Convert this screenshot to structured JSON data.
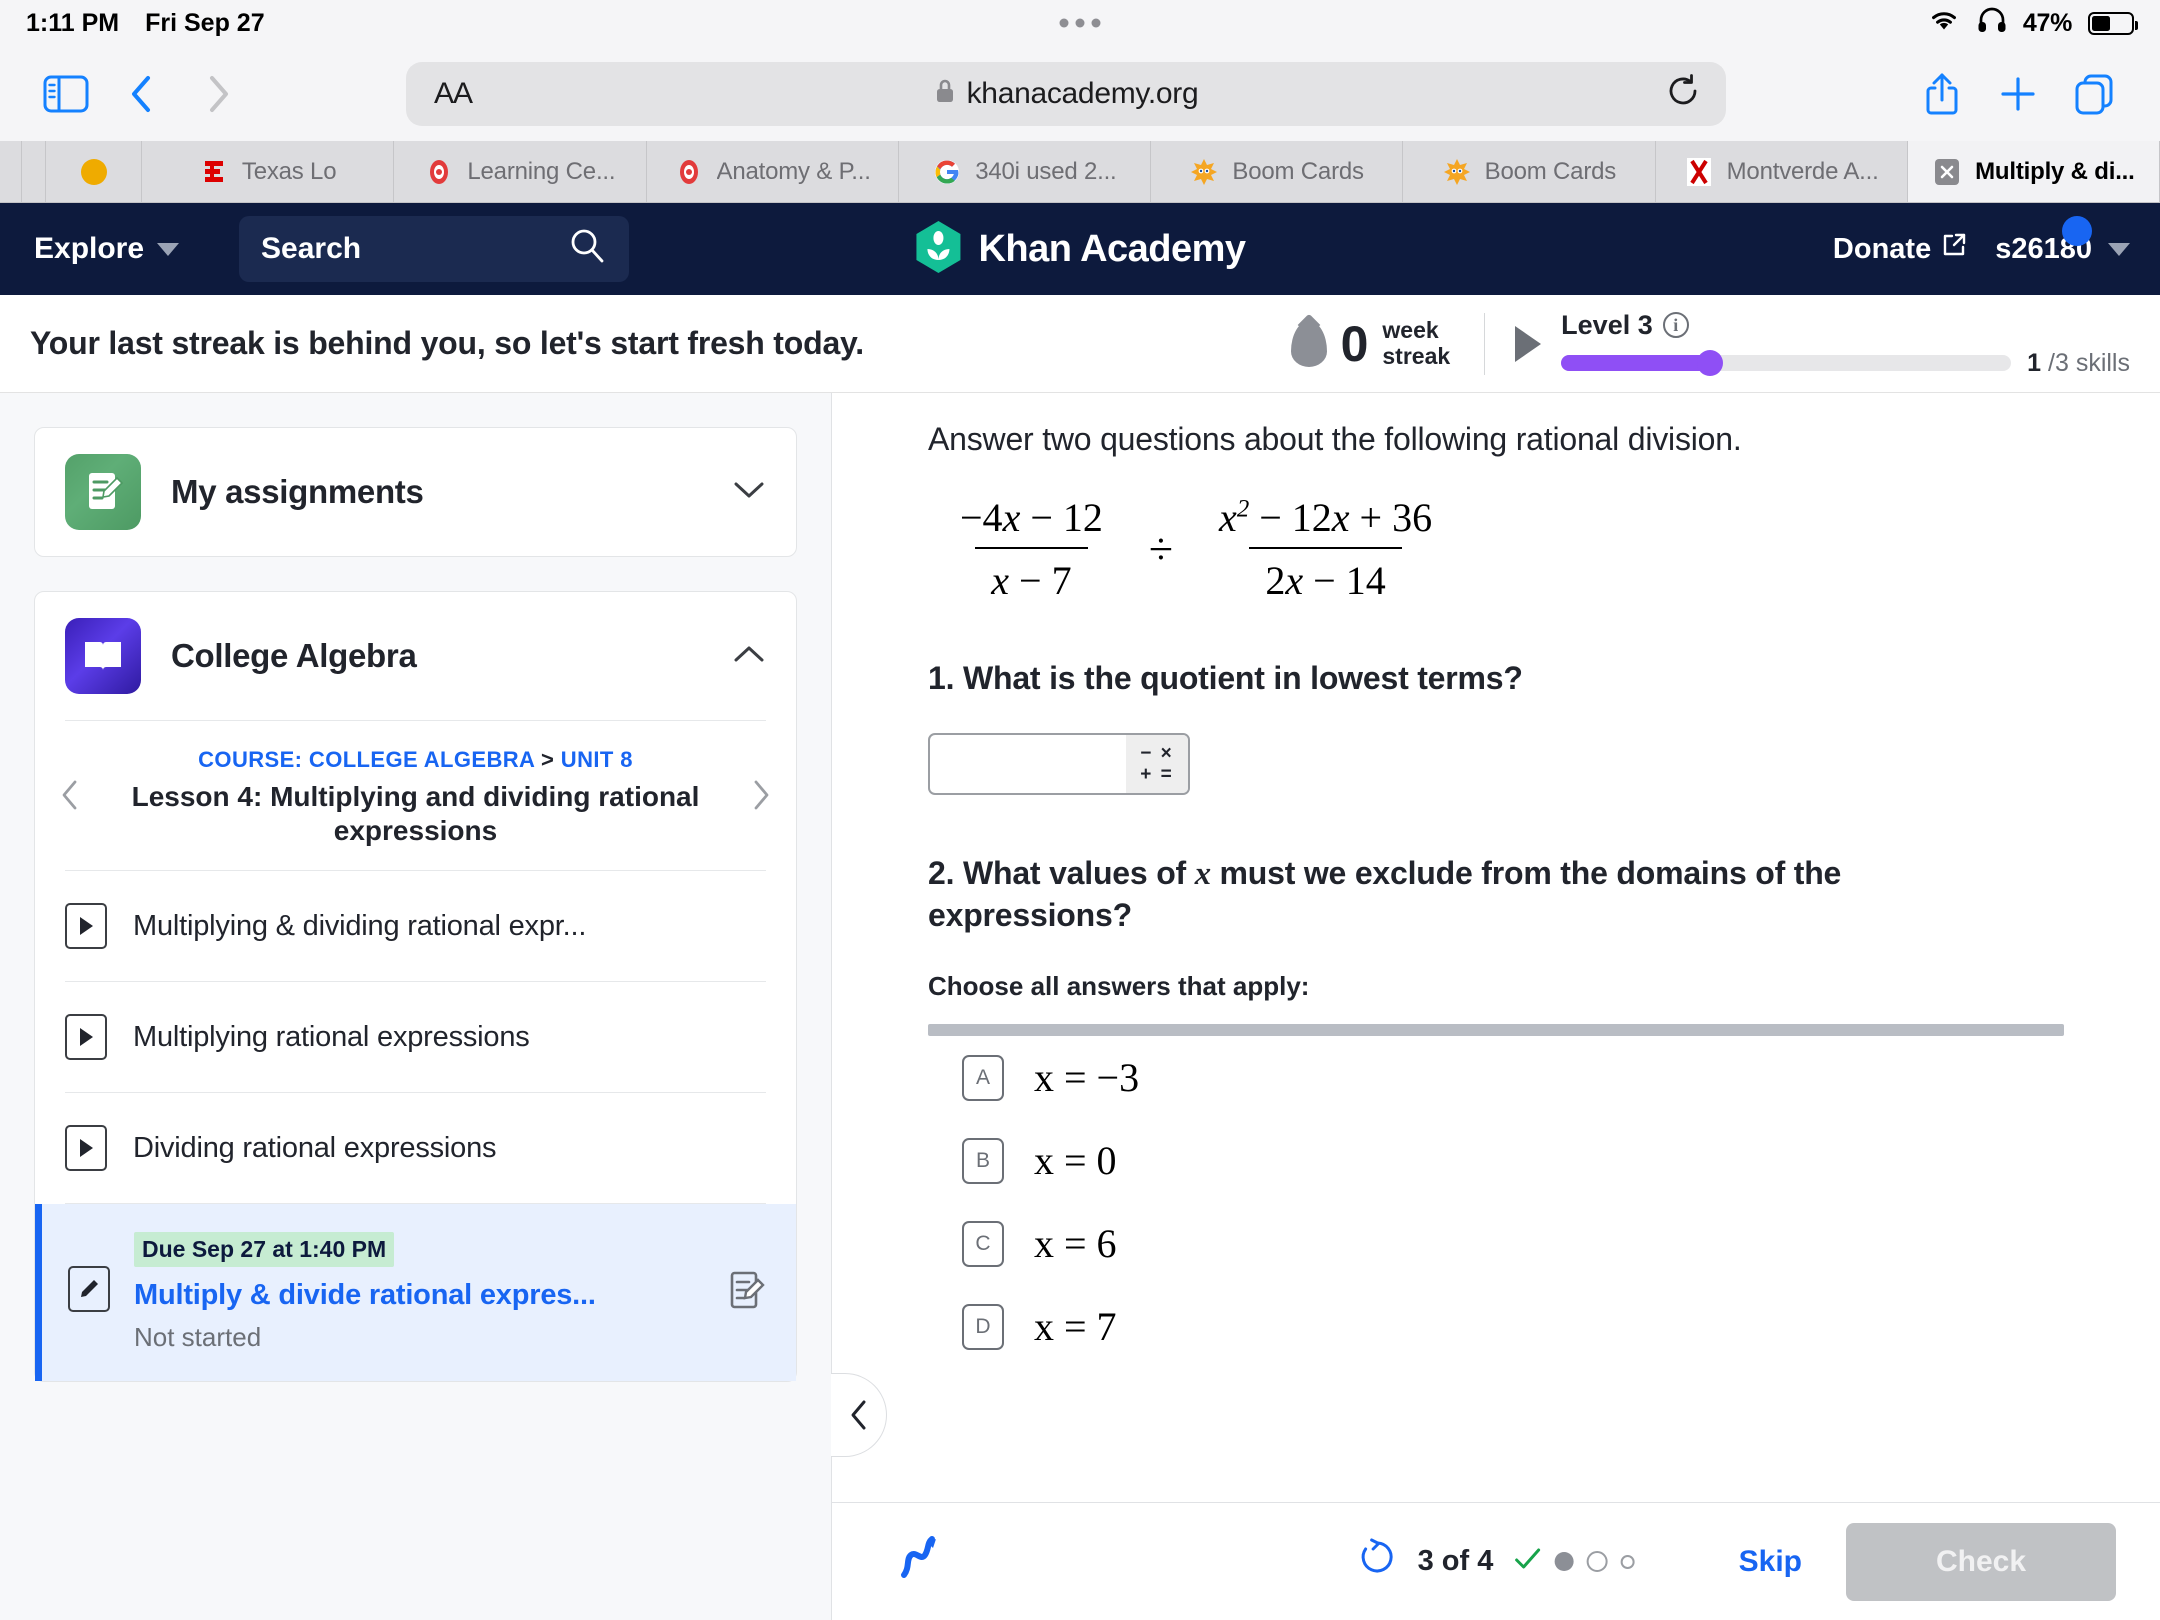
{
  "status_bar": {
    "time": "1:11 PM",
    "date": "Fri Sep 27",
    "battery_percent": "47%",
    "wifi_icon": "wifi-icon",
    "headphones_icon": "headphones-icon",
    "battery_icon": "battery-icon"
  },
  "browser": {
    "sidebar_icon": "sidebar-icon",
    "back_icon": "back-chevron-icon",
    "forward_icon": "forward-chevron-icon",
    "aa_label": "AA",
    "lock_icon": "lock-icon",
    "url": "khanacademy.org",
    "reload_icon": "reload-icon",
    "share_icon": "share-icon",
    "newtab_icon": "plus-icon",
    "tabs_icon": "tab-overview-icon",
    "tabs": [
      {
        "label": "",
        "icon": "blank-tab",
        "active": false,
        "kind": "slim"
      },
      {
        "label": "",
        "icon": "blank-tab",
        "active": false,
        "kind": "slim2"
      },
      {
        "label": "",
        "icon": "orange-dot-icon",
        "active": false,
        "kind": "dot"
      },
      {
        "label": "Texas Lo",
        "icon": "espn-icon",
        "active": false,
        "kind": "normal"
      },
      {
        "label": "Learning Ce...",
        "icon": "red-seal-icon",
        "active": false,
        "kind": "normal"
      },
      {
        "label": "Anatomy & P...",
        "icon": "red-seal-icon",
        "active": false,
        "kind": "normal"
      },
      {
        "label": "340i used 2...",
        "icon": "google-icon",
        "active": false,
        "kind": "normal"
      },
      {
        "label": "Boom Cards",
        "icon": "boom-icon",
        "active": false,
        "kind": "normal"
      },
      {
        "label": "Boom Cards",
        "icon": "boom-icon",
        "active": false,
        "kind": "normal"
      },
      {
        "label": "Montverde A...",
        "icon": "red-x-icon",
        "active": false,
        "kind": "normal"
      },
      {
        "label": "Multiply & di...",
        "icon": "gray-x-icon",
        "active": true,
        "kind": "normal"
      }
    ]
  },
  "khan_nav": {
    "explore_label": "Explore",
    "explore_caret_icon": "chevron-down-icon",
    "search_placeholder": "Search",
    "search_icon": "search-icon",
    "logo_text": "Khan Academy",
    "logo_icon": "khan-leaf-logo-icon",
    "donate_label": "Donate",
    "donate_external_icon": "external-link-icon",
    "user_name": "s26180",
    "user_caret_icon": "chevron-down-icon",
    "notification_badge_color": "#1865f2"
  },
  "streak_bar": {
    "message": "Your last streak is behind you, so let's start fresh today.",
    "streak_flame_icon": "flame-icon",
    "streak_count": "0",
    "streak_unit_line1": "week",
    "streak_unit_line2": "streak",
    "play_icon": "play-triangle-icon",
    "level_label": "Level 3",
    "info_icon": "info-icon",
    "progress_percent": 33,
    "progress_color": "#8f4ff5",
    "skills_done": "1",
    "skills_total": "/3 skills"
  },
  "sidebar": {
    "assignments_card": {
      "title": "My assignments",
      "icon": "assignment-green-icon",
      "chevron_icon": "chevron-down-icon"
    },
    "course_card": {
      "title": "College Algebra",
      "icon": "book-purple-icon",
      "chevron_icon": "chevron-up-icon"
    },
    "breadcrumb": {
      "course_label": "COURSE: COLLEGE ALGEBRA",
      "separator": ">",
      "unit_label": "UNIT 8",
      "lesson_title": "Lesson 4: Multiplying and dividing rational expressions",
      "prev_icon": "chevron-left-icon",
      "next_icon": "chevron-right-icon"
    },
    "lessons": [
      {
        "label": "Multiplying & dividing rational expr...",
        "icon": "video-play-icon"
      },
      {
        "label": "Multiplying rational expressions",
        "icon": "video-play-icon"
      },
      {
        "label": "Dividing rational expressions",
        "icon": "video-play-icon"
      }
    ],
    "assignment": {
      "due_badge": "Due Sep 27 at 1:40 PM",
      "title": "Multiply & divide rational expres...",
      "status": "Not started",
      "left_icon": "pencil-exercise-icon",
      "right_icon": "exercise-sheet-icon",
      "accent_color": "#1865f2"
    }
  },
  "exercise": {
    "prompt": "Answer two questions about the following rational division.",
    "expression": {
      "left_numerator": "−4x − 12",
      "left_denominator": "x − 7",
      "operator": "÷",
      "right_numerator": "x² − 12x + 36",
      "right_denominator": "2x − 14"
    },
    "question1": "1. What is the quotient in lowest terms?",
    "answer_input_value": "",
    "keypad_line1": "− ×",
    "keypad_line2": "+ =",
    "question2": "2. What values of x must we exclude from the domains of the expressions?",
    "choose_label": "Choose all answers that apply:",
    "choices": [
      {
        "key": "A",
        "math": "x = −3"
      },
      {
        "key": "B",
        "math": "x = 0"
      },
      {
        "key": "C",
        "math": "x = 6"
      },
      {
        "key": "D",
        "math": "x = 7"
      }
    ],
    "collapse_icon": "chevron-left-icon"
  },
  "exercise_footer": {
    "scratchpad_icon": "scratchpad-scribble-icon",
    "reset_icon": "reset-circular-arrow-icon",
    "progress_label": "3 of 4",
    "progress_marks": [
      "check",
      "filled",
      "open",
      "small"
    ],
    "skip_label": "Skip",
    "check_label": "Check"
  }
}
